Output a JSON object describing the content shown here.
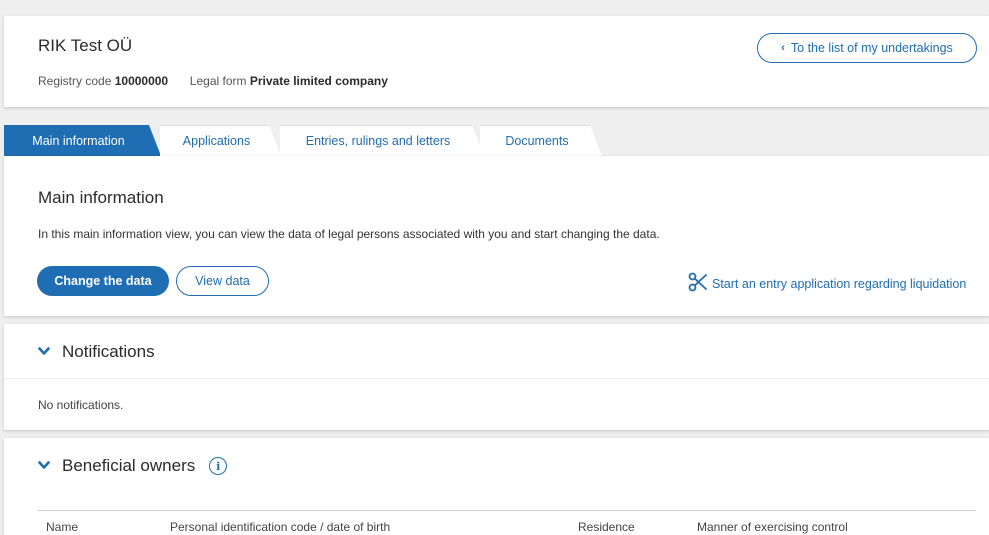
{
  "company": {
    "name": "RIK Test OÜ",
    "registry_code_label": "Registry code",
    "registry_code": "10000000",
    "legal_form_label": "Legal form",
    "legal_form": "Private limited company"
  },
  "header": {
    "back_button_label": "To the list of my undertakings"
  },
  "tabs": [
    {
      "label": "Main information",
      "active": true
    },
    {
      "label": "Applications",
      "active": false
    },
    {
      "label": "Entries, rulings and letters",
      "active": false
    },
    {
      "label": "Documents",
      "active": false
    }
  ],
  "main_info": {
    "title": "Main information",
    "description": "In this main information view, you can view the data of legal persons associated with you and start changing the data.",
    "change_button": "Change the data",
    "view_button": "View data",
    "liquidation_link": "Start an entry application regarding liquidation"
  },
  "notifications": {
    "title": "Notifications",
    "empty_text": "No notifications."
  },
  "beneficial_owners": {
    "title": "Beneficial owners",
    "columns": [
      "Name",
      "Personal identification code / date of birth",
      "Residence",
      "Manner of exercising control"
    ]
  },
  "colors": {
    "accent": "#1f6db2",
    "background": "#efefef"
  }
}
